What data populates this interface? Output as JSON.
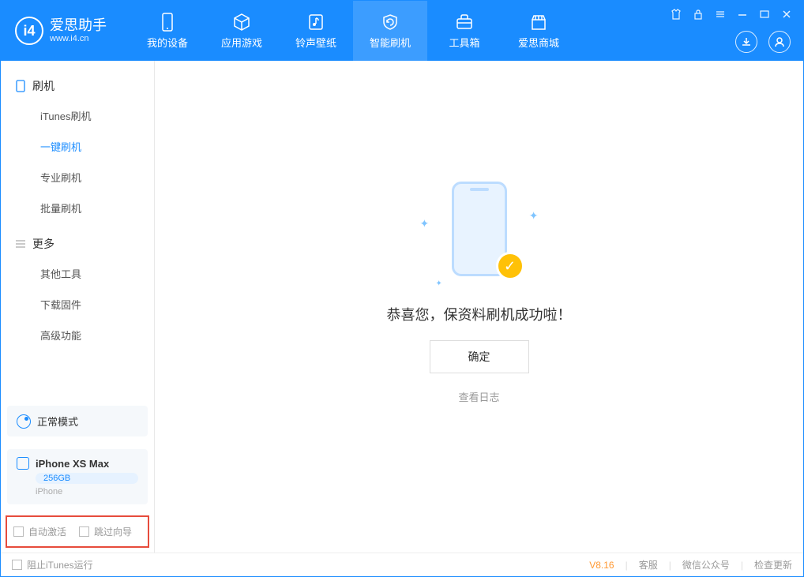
{
  "app": {
    "name": "爱思助手",
    "url": "www.i4.cn"
  },
  "tabs": {
    "device": "我的设备",
    "apps": "应用游戏",
    "ringtone": "铃声壁纸",
    "flash": "智能刷机",
    "toolbox": "工具箱",
    "store": "爱思商城"
  },
  "sidebar": {
    "section_flash": "刷机",
    "items_flash": {
      "itunes": "iTunes刷机",
      "oneclick": "一键刷机",
      "pro": "专业刷机",
      "batch": "批量刷机"
    },
    "section_more": "更多",
    "items_more": {
      "other": "其他工具",
      "firmware": "下载固件",
      "advanced": "高级功能"
    }
  },
  "device": {
    "mode": "正常模式",
    "name": "iPhone XS Max",
    "capacity": "256GB",
    "type": "iPhone"
  },
  "checkboxes": {
    "auto_activate": "自动激活",
    "skip_guide": "跳过向导"
  },
  "main": {
    "success": "恭喜您，保资料刷机成功啦！",
    "ok": "确定",
    "view_log": "查看日志"
  },
  "footer": {
    "block_itunes": "阻止iTunes运行",
    "version": "V8.16",
    "support": "客服",
    "wechat": "微信公众号",
    "update": "检查更新"
  }
}
